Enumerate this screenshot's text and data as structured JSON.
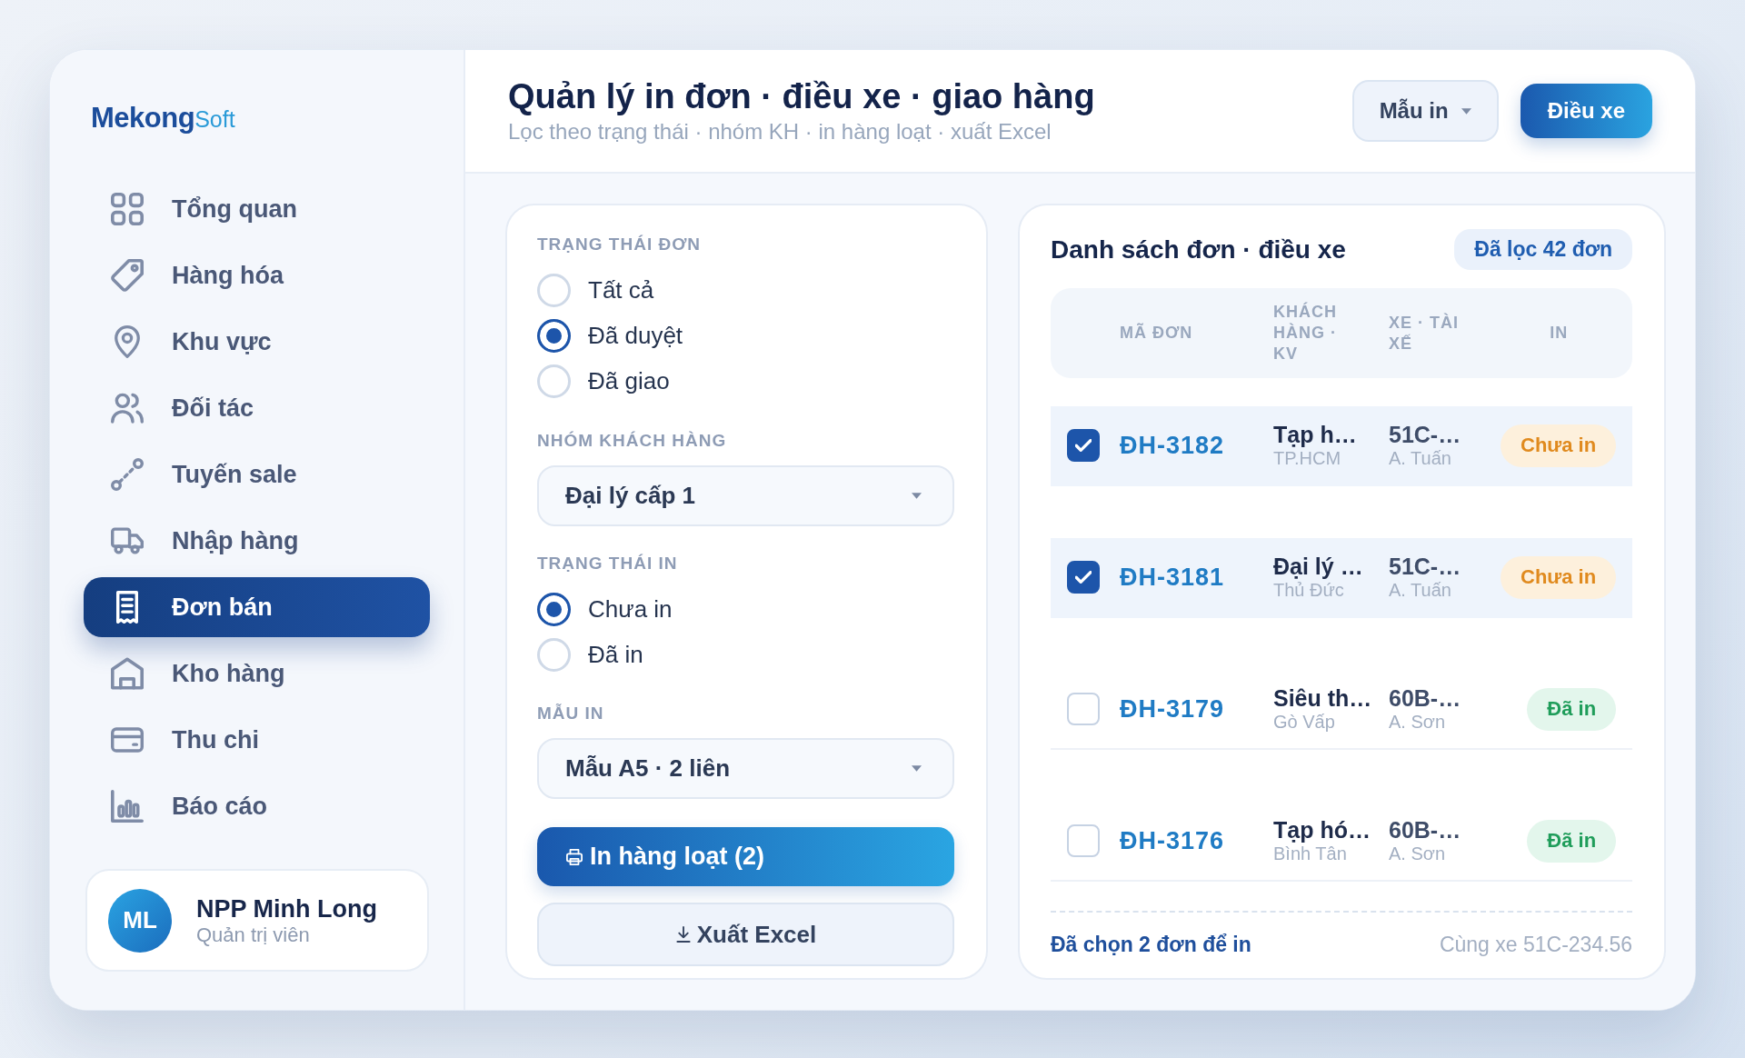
{
  "sidebar": {
    "logo": {
      "primary": "Mekong",
      "secondary": "Soft"
    },
    "nav_items": [
      {
        "label": "Tổng quan",
        "selected": false
      },
      {
        "label": "Hàng hóa",
        "selected": false
      },
      {
        "label": "Khu vực",
        "selected": false
      },
      {
        "label": "Đối tác",
        "selected": false
      },
      {
        "label": "Tuyến sale",
        "selected": false
      },
      {
        "label": "Nhập hàng",
        "selected": false
      },
      {
        "label": "Đơn bán",
        "selected": true
      },
      {
        "label": "Kho hàng",
        "selected": false
      },
      {
        "label": "Thu chi",
        "selected": false
      },
      {
        "label": "Báo cáo",
        "selected": false
      }
    ],
    "user": {
      "initials": "ML",
      "name": "NPP Minh Long",
      "role": "Quản trị viên"
    }
  },
  "header": {
    "title": "Quản lý in đơn · điều xe · giao hàng",
    "subtitle": "Lọc theo trạng thái · nhóm KH · in hàng loạt · xuất Excel",
    "actions": [
      {
        "kind": "dropdown",
        "label": "Mẫu in"
      },
      {
        "kind": "primary",
        "label": "Điều xe"
      }
    ]
  },
  "filters": {
    "groups": [
      {
        "kind": "radio",
        "label": "TRẠNG THÁI ĐƠN",
        "options": [
          {
            "label": "Tất cả",
            "selected": false
          },
          {
            "label": "Đã duyệt",
            "selected": true
          },
          {
            "label": "Đã giao",
            "selected": false
          }
        ]
      },
      {
        "kind": "select",
        "label": "NHÓM KHÁCH HÀNG",
        "value": "Đại lý cấp 1"
      },
      {
        "kind": "radio",
        "label": "TRẠNG THÁI IN",
        "options": [
          {
            "label": "Chưa in",
            "selected": true
          },
          {
            "label": "Đã in",
            "selected": false
          }
        ]
      },
      {
        "kind": "select",
        "label": "MẪU IN",
        "value": "Mẫu A5 · 2 liên"
      }
    ],
    "actions": [
      {
        "kind": "print",
        "label": "In hàng loạt (2)"
      },
      {
        "kind": "export",
        "label": "Xuất Excel"
      }
    ]
  },
  "orders": {
    "title": "Danh sách đơn · điều xe",
    "badge": "Đã lọc 42 đơn",
    "columns": [
      "MÃ ĐƠN",
      "KHÁCH HÀNG · KV",
      "XE · TÀI XẾ",
      "IN"
    ],
    "rows": [
      {
        "checked": true,
        "id": "ĐH-3182",
        "customer": "Tạp h…",
        "area": "TP.HCM",
        "vehicle": "51C-…",
        "driver": "A. Tuấn",
        "print_status": {
          "kind": "pending",
          "label": "Chưa in"
        }
      },
      {
        "checked": true,
        "id": "ĐH-3181",
        "customer": "Đại lý …",
        "area": "Thủ Đức",
        "vehicle": "51C-…",
        "driver": "A. Tuấn",
        "print_status": {
          "kind": "pending",
          "label": "Chưa in"
        }
      },
      {
        "checked": false,
        "id": "ĐH-3179",
        "customer": "Siêu th…",
        "area": "Gò Vấp",
        "vehicle": "60B-…",
        "driver": "A. Sơn",
        "print_status": {
          "kind": "printed",
          "label": "Đã in"
        }
      },
      {
        "checked": false,
        "id": "ĐH-3176",
        "customer": "Tạp hó…",
        "area": "Bình Tân",
        "vehicle": "60B-…",
        "driver": "A. Sơn",
        "print_status": {
          "kind": "printed",
          "label": "Đã in"
        }
      }
    ],
    "footer": {
      "summary": "Đã chọn 2 đơn để in",
      "note": "Cùng xe 51C-234.56"
    }
  }
}
